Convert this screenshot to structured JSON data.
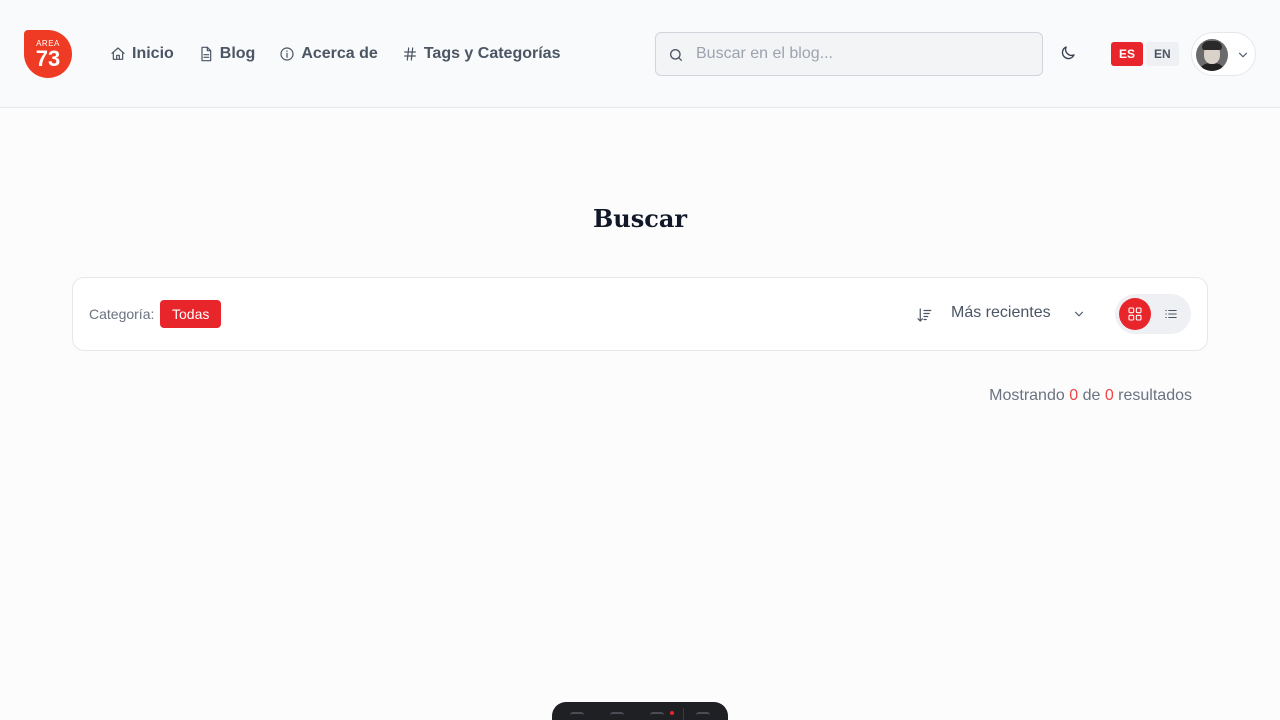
{
  "header": {
    "logo": {
      "top_text": "AREA",
      "number": "73",
      "color": "#ef3b24"
    },
    "nav": [
      {
        "label": "Inicio",
        "icon": "home-icon"
      },
      {
        "label": "Blog",
        "icon": "document-icon"
      },
      {
        "label": "Acerca de",
        "icon": "info-icon"
      },
      {
        "label": "Tags y Categorías",
        "icon": "hash-icon"
      }
    ],
    "search": {
      "placeholder": "Buscar en el blog..."
    },
    "theme_toggle_icon": "moon-icon",
    "languages": [
      {
        "label": "ES",
        "active": true
      },
      {
        "label": "EN",
        "active": false
      }
    ],
    "user_menu": {
      "avatar": "avatar",
      "icon": "chevron-down-icon"
    }
  },
  "main": {
    "title": "Buscar",
    "filters": {
      "category_label": "Categoría:",
      "category_selected": "Todas",
      "sort_icon": "sort-descending-icon",
      "sort_selected": "Más recientes",
      "view_modes": [
        {
          "name": "grid",
          "icon": "grid-icon",
          "active": true
        },
        {
          "name": "list",
          "icon": "list-icon",
          "active": false
        }
      ]
    },
    "results": {
      "prefix": "Mostrando",
      "shown": "0",
      "middle": "de",
      "total": "0",
      "suffix": "resultados"
    }
  },
  "colors": {
    "accent": "#e8252b",
    "text": "#1f2937",
    "muted": "#6b7280"
  }
}
